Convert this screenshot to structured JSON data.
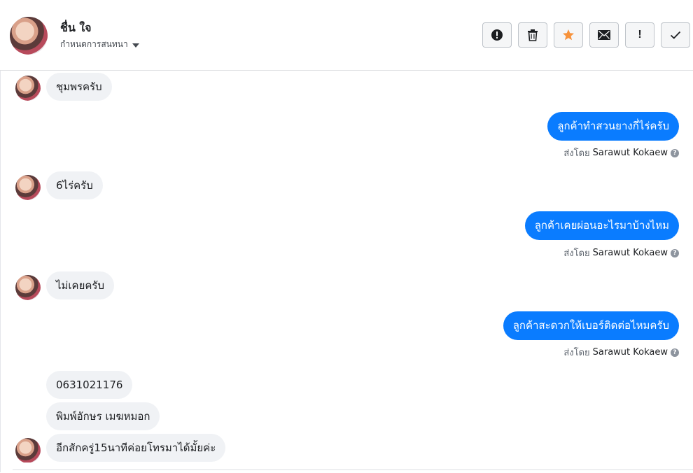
{
  "header": {
    "contact_name": "ชื่น ใจ",
    "assign_label": "กำหนดการสนทนา",
    "toolbar": [
      {
        "name": "report-button",
        "icon": "exclamation-circle-icon"
      },
      {
        "name": "delete-button",
        "icon": "trash-icon"
      },
      {
        "name": "star-button",
        "icon": "star-icon",
        "color": "#f7923b"
      },
      {
        "name": "mark-unread-button",
        "icon": "envelope-icon"
      },
      {
        "name": "spam-button",
        "icon": "exclamation-icon"
      },
      {
        "name": "done-button",
        "icon": "check-icon"
      }
    ]
  },
  "messages": [
    {
      "dir": "in",
      "text": "ชุมพรครับ"
    },
    {
      "dir": "out",
      "text": "ลูกค้าทำสวนยางกี่ไร่ครับ",
      "sent_prefix": "ส่งโดย",
      "sent_by": "Sarawut Kokaew"
    },
    {
      "dir": "in",
      "text": "6ไร่ครับ"
    },
    {
      "dir": "out",
      "text": "ลูกค้าเคยผ่อนอะไรมาบ้างไหม",
      "sent_prefix": "ส่งโดย",
      "sent_by": "Sarawut Kokaew"
    },
    {
      "dir": "in",
      "text": "ไม่เคยครับ"
    },
    {
      "dir": "out",
      "text": "ลูกค้าสะดวกให้เบอร์ติดต่อไหมครับ",
      "sent_prefix": "ส่งโดย",
      "sent_by": "Sarawut Kokaew"
    },
    {
      "dir": "in",
      "text": "0631021176"
    },
    {
      "dir": "in",
      "text": "พิมพ์อักษร เมฆหมอก"
    },
    {
      "dir": "in",
      "text": "อีกสักครู่15นาทีค่อยโทรมาได้มั้ยค่ะ"
    }
  ],
  "colors": {
    "outgoing_bubble": "#0a7cff",
    "incoming_bubble": "#f0f2f5",
    "star": "#f7923b"
  }
}
